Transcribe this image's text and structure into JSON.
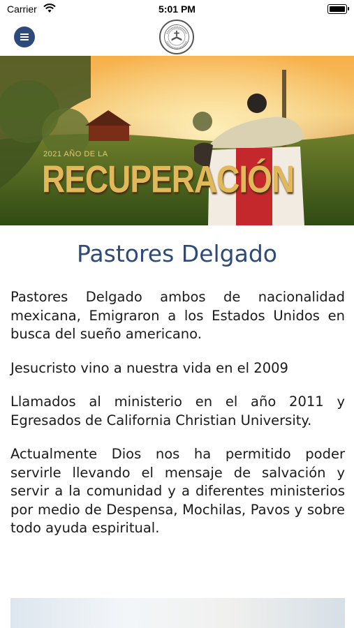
{
  "status_bar": {
    "carrier": "Carrier",
    "time": "5:01 PM",
    "icons": [
      "wifi-icon",
      "battery-icon"
    ]
  },
  "nav": {
    "menu_icon": "hamburger-menu-icon",
    "logo_icon": "church-logo"
  },
  "hero": {
    "year_label": "2021 AÑO DE LA",
    "title": "RECUPERACIÓN"
  },
  "page": {
    "title": "Pastores Delgado",
    "paragraphs": [
      "Pastores Delgado ambos de nacionalidad mexicana, Emigraron a los Estados Unidos en busca del sueño americano.",
      "Jesucristo vino a nuestra vida en el 2009",
      "Llamados al ministerio en el año 2011 y Egresados de California Christian University.",
      "Actualmente Dios nos ha permitido poder servirle llevando el mensaje de salvación y servir a la comunidad y a diferentes ministerios por medio de Despensa, Mochilas, Pavos y sobre todo ayuda espiritual."
    ]
  },
  "colors": {
    "accent": "#2d4a7a",
    "hero_gold": "#e2b95a"
  }
}
